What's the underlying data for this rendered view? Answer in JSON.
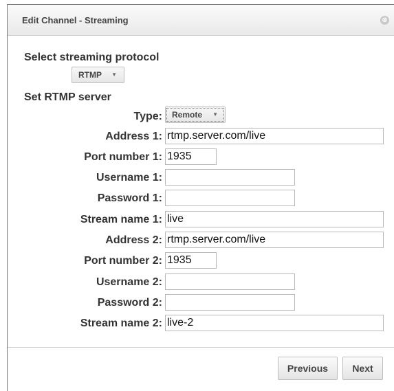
{
  "dialog": {
    "title": "Edit Channel - Streaming",
    "close_icon": "close-icon",
    "close_glyph": "⊗"
  },
  "protocol": {
    "heading": "Select streaming protocol",
    "selected": "RTMP"
  },
  "server": {
    "heading": "Set RTMP server",
    "type_label": "Type:",
    "type_selected": "Remote",
    "address1_label": "Address 1:",
    "address1_value": "rtmp.server.com/live",
    "port1_label": "Port number 1:",
    "port1_value": "1935",
    "username1_label": "Username 1:",
    "username1_value": "",
    "password1_label": "Password 1:",
    "password1_value": "",
    "stream1_label": "Stream name 1:",
    "stream1_value": "live",
    "address2_label": "Address 2:",
    "address2_value": "rtmp.server.com/live",
    "port2_label": "Port number 2:",
    "port2_value": "1935",
    "username2_label": "Username 2:",
    "username2_value": "",
    "password2_label": "Password 2:",
    "password2_value": "",
    "stream2_label": "Stream name 2:",
    "stream2_value": "live-2"
  },
  "footer": {
    "previous_label": "Previous",
    "next_label": "Next"
  }
}
